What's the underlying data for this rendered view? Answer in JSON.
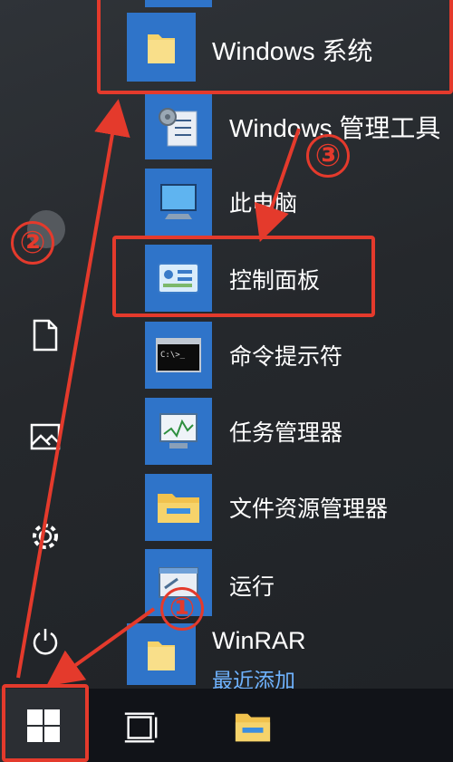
{
  "start_menu": {
    "items": [
      {
        "label": "Windows 系统",
        "icon": "folder-icon"
      },
      {
        "label": "Windows 管理工具",
        "icon": "admin-tools-icon"
      },
      {
        "label": "此电脑",
        "icon": "computer-icon"
      },
      {
        "label": "控制面板",
        "icon": "control-panel-icon"
      },
      {
        "label": "命令提示符",
        "icon": "cmd-icon"
      },
      {
        "label": "任务管理器",
        "icon": "task-manager-icon"
      },
      {
        "label": "文件资源管理器",
        "icon": "file-explorer-icon"
      },
      {
        "label": "运行",
        "icon": "run-icon"
      },
      {
        "label": "WinRAR",
        "sublabel": "最近添加",
        "icon": "folder-icon"
      }
    ]
  },
  "left_rail": {
    "icons": [
      "user-avatar-icon",
      "document-icon",
      "pictures-icon",
      "settings-gear-icon",
      "power-icon"
    ]
  },
  "taskbar": {
    "icons": [
      "windows-start-icon",
      "task-view-icon",
      "file-explorer-icon"
    ]
  },
  "annotations": {
    "step1": "①",
    "step2": "②",
    "step3": "③",
    "color": "#e43a2c"
  },
  "colors": {
    "tile": "#2f74c9",
    "accent_text": "#6fb3ff",
    "background": "#2a2d31"
  }
}
